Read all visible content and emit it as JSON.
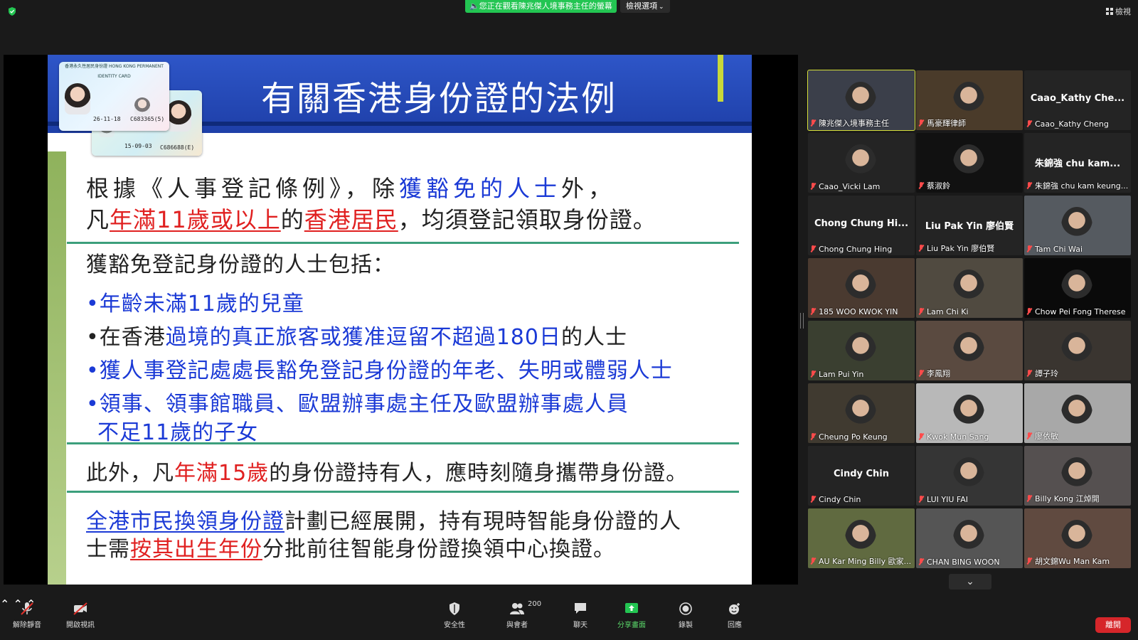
{
  "top": {
    "share_banner": "您正在觀看陳兆傑人境事務主任的螢幕",
    "view_options": "檢視選項",
    "view_label": "檢視"
  },
  "slide": {
    "title": "有關香港身份證的法例",
    "para1": {
      "l1a": "根據《人事登記條例》，除",
      "l1b": "獲豁免的人士",
      "l1c": "外，",
      "l2a": "凡",
      "l2b": "年滿11歲或以上",
      "l2c": "的",
      "l2d": "香港居民",
      "l2e": "，均須登記領取身份證。"
    },
    "exempt_heading": "獲豁免登記身份證的人士包括：",
    "bullets": {
      "b1": "•年齡未滿11歲的兒童",
      "b2a": "•在香港",
      "b2b": "過境的真正旅客或獲准逗留不超過180日",
      "b2c": "的人士",
      "b3": "•獲人事登記處處長豁免登記身份證的年老、失明或體弱人士",
      "b4l1": "•領事、領事館職員、歐盟辦事處主任及歐盟辦事處人員",
      "b4l2": "不足11歲的子女"
    },
    "carry": {
      "a": "此外，凡",
      "b": "年滿15歲",
      "c": "的身份證持有人，應時刻隨身攜帶身份證。"
    },
    "replace": {
      "l1a": "全港市民換領身份證",
      "l1b": "計劃已經展開，持有現時智能身份證的人",
      "l2a": "士需",
      "l2b": "按其出生年份",
      "l2c": "分批前往智能身份證換領中心換證。"
    },
    "id_card": {
      "header": "香港永久性居民身份證 HONG KONG PERMANENT IDENTITY CARD",
      "number1": "C683365(5)",
      "number2": "C686688(E)",
      "date1": "26-11-18",
      "date2": "15-09-03"
    }
  },
  "gallery": {
    "tiles": [
      {
        "label": "陳兆傑入境事務主任",
        "center": ""
      },
      {
        "label": "馬豪輝律師",
        "center": ""
      },
      {
        "label": "Caao_Kathy Cheng",
        "center": "Caao_Kathy Che..."
      },
      {
        "label": "Caao_Vicki Lam",
        "center": ""
      },
      {
        "label": "蔡淑鈴",
        "center": ""
      },
      {
        "label": "朱錦強 chu kam keung...",
        "center": "朱錦強 chu kam..."
      },
      {
        "label": "Chong Chung Hing",
        "center": "Chong Chung Hi..."
      },
      {
        "label": "Liu Pak Yin 廖伯賢",
        "center": "Liu Pak Yin 廖伯賢"
      },
      {
        "label": "Tam Chi Wai",
        "center": ""
      },
      {
        "label": "185 WOO KWOK YIN",
        "center": ""
      },
      {
        "label": "Lam Chi Ki",
        "center": ""
      },
      {
        "label": "Chow Pei Fong Therese",
        "center": ""
      },
      {
        "label": "Lam Pui Yin",
        "center": ""
      },
      {
        "label": "李鳳翔",
        "center": ""
      },
      {
        "label": "譚子玲",
        "center": ""
      },
      {
        "label": "Cheung Po Keung",
        "center": ""
      },
      {
        "label": "Kwok Mun Sang",
        "center": ""
      },
      {
        "label": "廖依敏",
        "center": ""
      },
      {
        "label": "Cindy Chin",
        "center": "Cindy Chin"
      },
      {
        "label": "LUI YIU FAI",
        "center": ""
      },
      {
        "label": "Billy Kong 江焯開",
        "center": ""
      },
      {
        "label": "AU Kar Ming Billy 歐家...",
        "center": ""
      },
      {
        "label": "CHAN BING WOON",
        "center": ""
      },
      {
        "label": "胡文錦Wu Man Kam",
        "center": ""
      }
    ]
  },
  "toolbar": {
    "unmute": "解除靜音",
    "start_video": "開啟視訊",
    "security": "安全性",
    "participants": "與會者",
    "participant_count": "200",
    "chat": "聊天",
    "share_screen": "分享畫面",
    "record": "錄製",
    "reactions": "回應",
    "leave": "離開"
  },
  "colors": {
    "slide_blue": "#1b3ad6",
    "slide_red": "#e02020",
    "active_speaker": "#d6e03a",
    "share_green": "#23c552",
    "leave_red": "#d6262a"
  }
}
